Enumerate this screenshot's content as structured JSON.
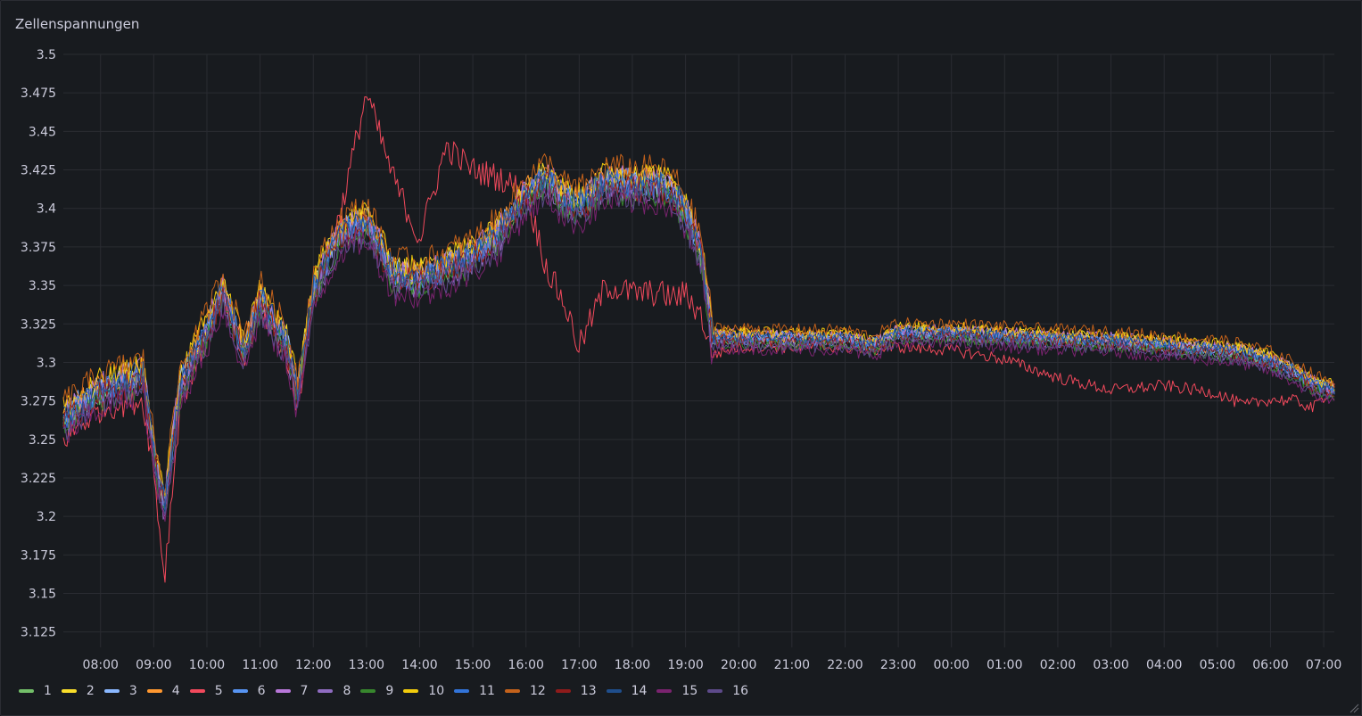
{
  "panel": {
    "title": "Zellenspannungen"
  },
  "chart_data": {
    "type": "line",
    "title": "Zellenspannungen",
    "xlabel": "",
    "ylabel": "",
    "x_ticks": [
      "08:00",
      "09:00",
      "10:00",
      "11:00",
      "12:00",
      "13:00",
      "14:00",
      "15:00",
      "16:00",
      "17:00",
      "18:00",
      "19:00",
      "20:00",
      "21:00",
      "22:00",
      "23:00",
      "00:00",
      "01:00",
      "02:00",
      "03:00",
      "04:00",
      "05:00",
      "06:00",
      "07:00"
    ],
    "y_ticks": [
      "3.125",
      "3.15",
      "3.175",
      "3.2",
      "3.225",
      "3.25",
      "3.275",
      "3.3",
      "3.325",
      "3.35",
      "3.375",
      "3.4",
      "3.425",
      "3.45",
      "3.475",
      "3.5"
    ],
    "ylim": [
      3.115,
      3.5
    ],
    "xlim_hours": [
      7.3,
      31.2
    ],
    "grid": true,
    "legend_placement": "bottom-left",
    "x_hours": [
      7.3,
      8,
      8.6,
      8.8,
      9,
      9.2,
      9.5,
      10,
      10.3,
      10.7,
      11,
      11.5,
      11.7,
      12,
      12.5,
      13,
      13.5,
      14,
      14.5,
      15,
      15.5,
      16,
      16.4,
      16.7,
      17,
      17.5,
      18,
      18.5,
      18.8,
      19,
      19.3,
      19.5,
      20,
      21,
      22,
      22.5,
      23,
      24,
      25,
      26,
      27,
      28,
      29,
      29.5,
      30,
      30.5,
      30.8,
      31.2
    ],
    "base_values": [
      3.262,
      3.28,
      3.288,
      3.29,
      3.24,
      3.205,
      3.285,
      3.32,
      3.345,
      3.305,
      3.34,
      3.31,
      3.278,
      3.345,
      3.382,
      3.39,
      3.356,
      3.352,
      3.36,
      3.368,
      3.382,
      3.408,
      3.418,
      3.405,
      3.4,
      3.415,
      3.414,
      3.414,
      3.408,
      3.395,
      3.37,
      3.315,
      3.315,
      3.314,
      3.314,
      3.31,
      3.318,
      3.318,
      3.316,
      3.314,
      3.313,
      3.31,
      3.307,
      3.305,
      3.3,
      3.292,
      3.285,
      3.28
    ],
    "cell5_values": [
      3.25,
      3.27,
      3.275,
      3.275,
      3.23,
      3.16,
      3.275,
      3.315,
      3.345,
      3.3,
      3.335,
      3.305,
      3.27,
      3.345,
      3.395,
      3.475,
      3.42,
      3.38,
      3.44,
      3.425,
      3.42,
      3.41,
      3.36,
      3.34,
      3.31,
      3.35,
      3.345,
      3.345,
      3.342,
      3.345,
      3.33,
      3.305,
      3.31,
      3.31,
      3.31,
      3.308,
      3.31,
      3.308,
      3.302,
      3.29,
      3.282,
      3.285,
      3.28,
      3.272,
      3.276,
      3.275,
      3.27,
      3.285
    ],
    "series": [
      {
        "name": "1",
        "color": "#73bf69",
        "offset": 0.0
      },
      {
        "name": "2",
        "color": "#fade2a",
        "offset": 0.006
      },
      {
        "name": "3",
        "color": "#8ab8ff",
        "offset": 0.004
      },
      {
        "name": "4",
        "color": "#ff9830",
        "offset": 0.004
      },
      {
        "name": "5",
        "color": "#f2495c",
        "offset": 0.0
      },
      {
        "name": "6",
        "color": "#5794f2",
        "offset": 0.001
      },
      {
        "name": "7",
        "color": "#b877d9",
        "offset": 0.005
      },
      {
        "name": "8",
        "color": "#8f6cc1",
        "offset": -0.002
      },
      {
        "name": "9",
        "color": "#37872d",
        "offset": -0.004
      },
      {
        "name": "10",
        "color": "#f2cc0c",
        "offset": 0.008
      },
      {
        "name": "11",
        "color": "#3274d9",
        "offset": 0.002
      },
      {
        "name": "12",
        "color": "#c4621b",
        "offset": 0.012
      },
      {
        "name": "13",
        "color": "#8f1b1b",
        "offset": -0.001
      },
      {
        "name": "14",
        "color": "#1f4e8c",
        "offset": 0.003
      },
      {
        "name": "15",
        "color": "#7a236f",
        "offset": -0.01
      },
      {
        "name": "16",
        "color": "#5d4a8a",
        "offset": -0.006
      }
    ]
  }
}
